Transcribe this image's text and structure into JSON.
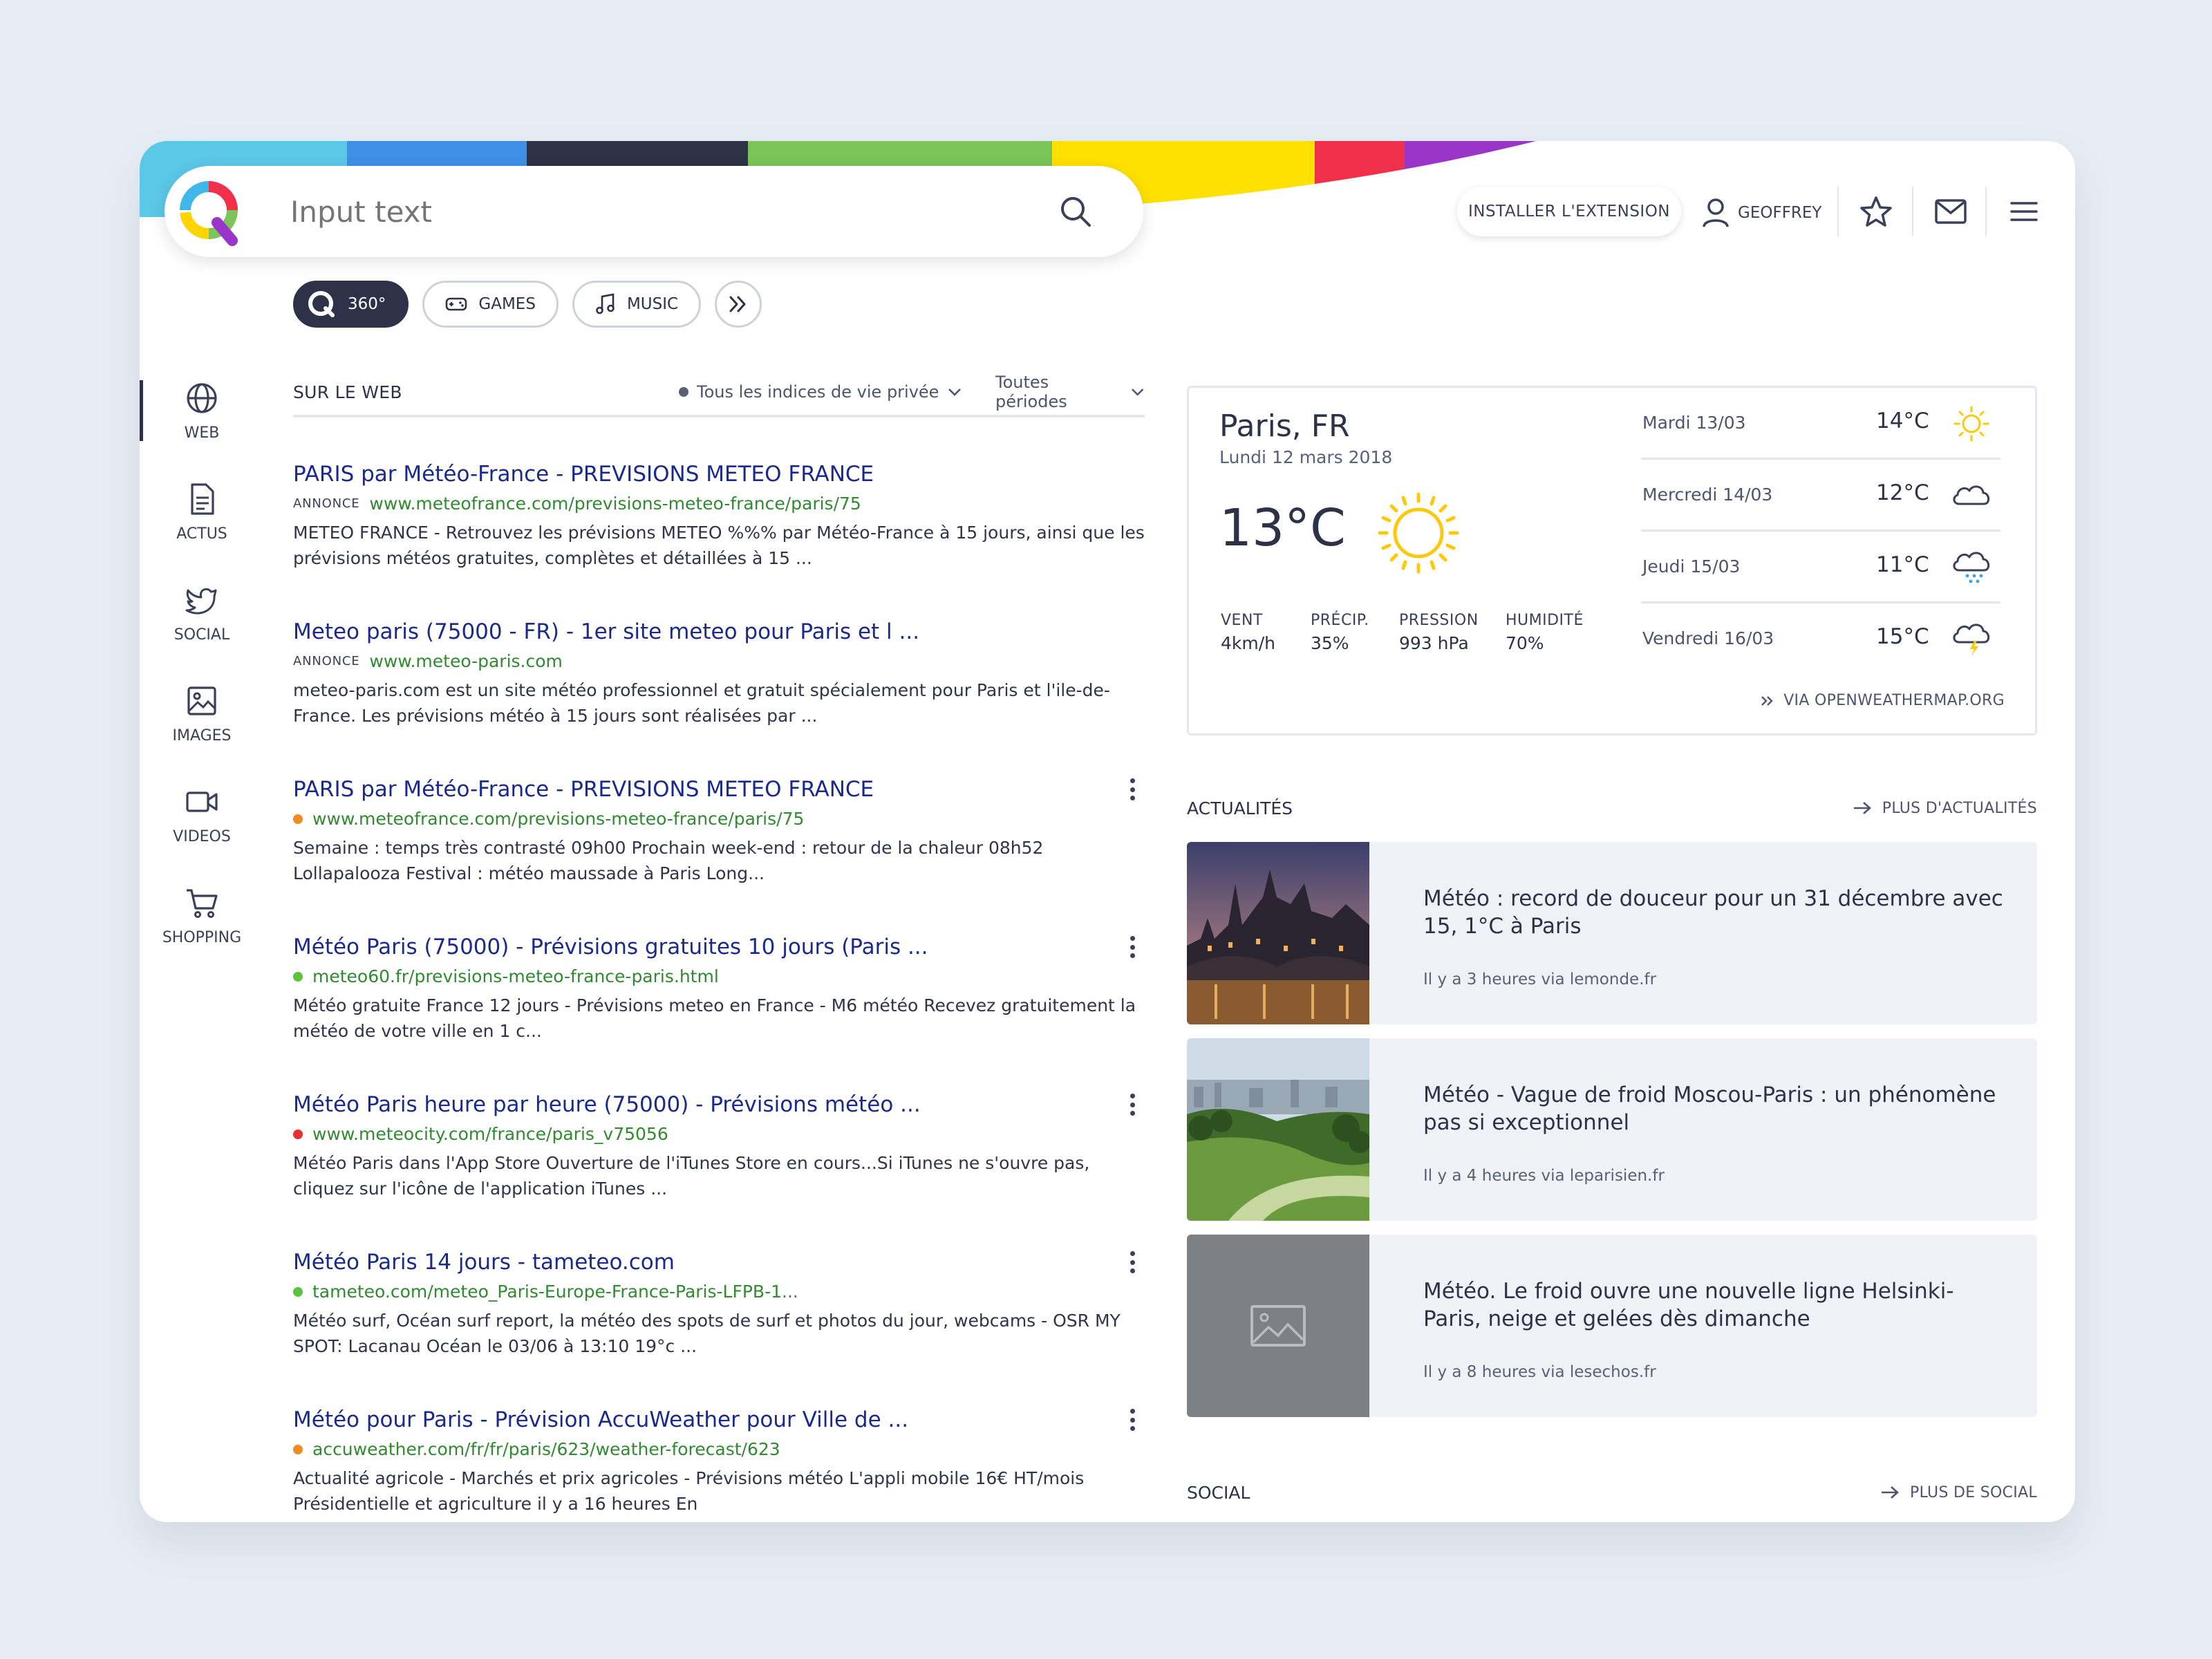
{
  "search": {
    "placeholder": "Input text"
  },
  "header": {
    "install_label": "INSTALLER L'EXTENSION",
    "user_name": "GEOFFREY"
  },
  "filters": [
    {
      "label": "360°"
    },
    {
      "label": "GAMES"
    },
    {
      "label": "MUSIC"
    }
  ],
  "sidebar": {
    "items": [
      {
        "label": "WEB"
      },
      {
        "label": "ACTUS"
      },
      {
        "label": "SOCIAL"
      },
      {
        "label": "IMAGES"
      },
      {
        "label": "VIDEOS"
      },
      {
        "label": "SHOPPING"
      }
    ]
  },
  "results_header": {
    "title": "SUR LE WEB",
    "privacy_filter": "Tous les indices de vie privée",
    "period_filter": "Toutes périodes"
  },
  "results": [
    {
      "title": "PARIS par Météo-France - PREVISIONS METEO FRANCE",
      "badge": "ANNONCE",
      "url": "www.meteofrance.com/previsions-meteo-france/paris/75",
      "snippet": "METEO FRANCE - Retrouvez les prévisions METEO %%% par Météo-France à 15 jours, ainsi que les prévisions météos gratuites, complètes et détaillées à 15 ..."
    },
    {
      "title": "Meteo paris (75000 - FR) - 1er site meteo pour Paris et l ...",
      "badge": "ANNONCE",
      "url": "www.meteo-paris.com",
      "snippet": "meteo-paris.com est un site météo professionnel et gratuit spécialement pour Paris et l'ile-de-France. Les prévisions météo à 15 jours sont réalisées par ..."
    },
    {
      "title": "PARIS par Météo-France - PREVISIONS METEO FRANCE",
      "dot_color": "#f08a24",
      "url": "www.meteofrance.com/previsions-meteo-france/paris/75",
      "snippet": " Semaine : temps très contrasté 09h00 Prochain week-end : retour de la chaleur 08h52 Lollapalooza Festival : météo maussade à Paris Long..."
    },
    {
      "title": "Météo Paris (75000) - Prévisions gratuites 10 jours (Paris ...",
      "dot_color": "#5cc33f",
      "url": "meteo60.fr/previsions-meteo-france-paris.html",
      "snippet": "Météo gratuite France 12 jours - Prévisions meteo en France - M6 météo Recevez gratuitement la météo de votre ville en 1 c..."
    },
    {
      "title": "Météo Paris heure par heure (75000) - Prévisions météo ...",
      "dot_color": "#e9302f",
      "url": "www.meteocity.com/france/paris_v75056",
      "snippet": "Météo Paris dans l'App Store Ouverture de l'iTunes Store en cours...Si iTunes ne s'ouvre pas, cliquez sur l'icône de l'application iTunes ..."
    },
    {
      "title": "Météo Paris 14 jours - tameteo.com",
      "dot_color": "#5cc33f",
      "url": "tameteo.com/meteo_Paris-Europe-France-Paris-LFPB-1...",
      "snippet": "Météo surf, Océan surf report, la météo des spots de surf et photos du jour, webcams - OSR MY SPOT: Lacanau Océan le 03/06 à 13:10 19°c ..."
    },
    {
      "title": "Météo pour Paris - Prévision AccuWeather pour Ville de ...",
      "dot_color": "#f08a24",
      "url": "accuweather.com/fr/fr/paris/623/weather-forecast/623",
      "snippet": "Actualité agricole - Marchés et prix agricoles - Prévisions météo L'appli mobile 16€ HT/mois Présidentielle et agriculture il y a 16 heures En"
    }
  ],
  "weather": {
    "city": "Paris, FR",
    "date": "Lundi 12 mars 2018",
    "temp": "13°C",
    "stats": [
      {
        "label": "VENT",
        "value": "4km/h"
      },
      {
        "label": "PRÉCIP.",
        "value": "35%"
      },
      {
        "label": "PRESSION",
        "value": "993 hPa"
      },
      {
        "label": "HUMIDITÉ",
        "value": "70%"
      }
    ],
    "forecast": [
      {
        "day": "Mardi 13/03",
        "temp": "14°C",
        "icon": "sun-icon"
      },
      {
        "day": "Mercredi 14/03",
        "temp": "12°C",
        "icon": "cloud-icon"
      },
      {
        "day": "Jeudi 15/03",
        "temp": "11°C",
        "icon": "snow-cloud-icon"
      },
      {
        "day": "Vendredi 16/03",
        "temp": "15°C",
        "icon": "storm-cloud-icon"
      }
    ],
    "source": "VIA OPENWEATHERMAP.ORG"
  },
  "news_section": {
    "title": "ACTUALITÉS",
    "more": "PLUS D'ACTUALITÉS",
    "items": [
      {
        "title": "Météo : record de douceur pour un 31 décembre avec 15, 1°C à Paris",
        "meta": "Il y a 3 heures via lemonde.fr"
      },
      {
        "title": "Météo - Vague de froid Moscou-Paris : un phénomène pas si exceptionnel",
        "meta": "Il y a 4 heures via leparisien.fr"
      },
      {
        "title": "Météo. Le froid ouvre une nouvelle ligne Helsinki-Paris, neige et gelées dès dimanche",
        "meta": "Il y a 8 heures via lesechos.fr"
      }
    ]
  },
  "social_section": {
    "title": "SOCIAL",
    "more": "PLUS DE SOCIAL"
  },
  "colors": {
    "accent": "#2d3249",
    "link": "#1a2a8c",
    "url": "#2f8a30"
  }
}
